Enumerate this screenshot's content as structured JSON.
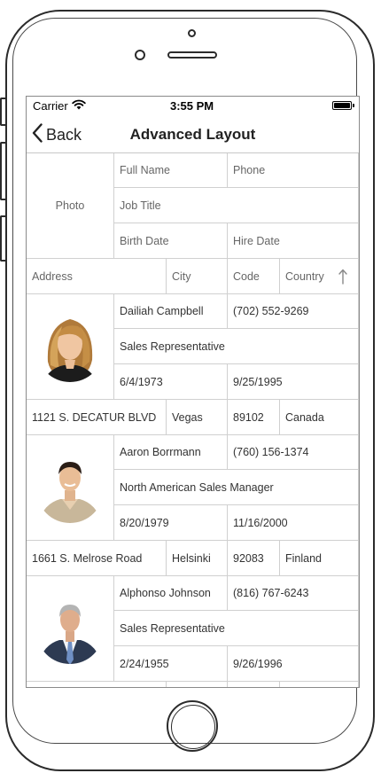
{
  "status_bar": {
    "carrier": "Carrier",
    "time": "3:55 PM"
  },
  "nav": {
    "back_label": "Back",
    "title": "Advanced Layout"
  },
  "header": {
    "photo": "Photo",
    "full_name": "Full Name",
    "phone": "Phone",
    "job_title": "Job Title",
    "birth_date": "Birth Date",
    "hire_date": "Hire Date",
    "address": "Address",
    "city": "City",
    "code": "Code",
    "country": "Country"
  },
  "employees": [
    {
      "full_name": "Dailiah Campbell",
      "phone": "(702) 552-9269",
      "job_title": "Sales Representative",
      "birth_date": "6/4/1973",
      "hire_date": "9/25/1995",
      "address": "1121 S. DECATUR BLVD",
      "city": "Vegas",
      "code": "89102",
      "country": "Canada",
      "photo": "woman-blonde-portrait"
    },
    {
      "full_name": "Aaron Borrmann",
      "phone": "(760) 156-1374",
      "job_title": "North American Sales Manager",
      "birth_date": "8/20/1979",
      "hire_date": "11/16/2000",
      "address": "1661 S. Melrose Road",
      "city": "Helsinki",
      "code": "92083",
      "country": "Finland",
      "photo": "man-khaki-shirt-portrait"
    },
    {
      "full_name": "Alphonso Johnson",
      "phone": "(816) 767-6243",
      "job_title": "Sales Representative",
      "birth_date": "2/24/1955",
      "hire_date": "9/26/1996",
      "address": "",
      "city": "",
      "code": "",
      "country": "",
      "photo": "man-suit-portrait"
    }
  ],
  "icons": {
    "back": "chevron-left-icon",
    "wifi": "wifi-icon",
    "battery": "battery-icon",
    "sort": "sort-ascending-icon"
  }
}
